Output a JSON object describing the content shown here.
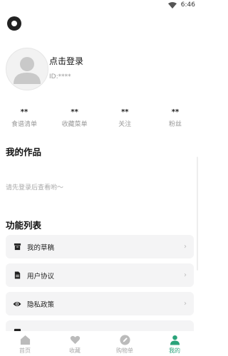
{
  "status_bar": {
    "time": "6:46"
  },
  "profile": {
    "login_text": "点击登录",
    "user_id": "ID:****"
  },
  "stats": [
    {
      "value": "**",
      "label": "食谱清单"
    },
    {
      "value": "**",
      "label": "收藏菜单"
    },
    {
      "value": "**",
      "label": "关注"
    },
    {
      "value": "**",
      "label": "粉丝"
    }
  ],
  "works": {
    "title": "我的作品",
    "empty_hint": "请先登录后查看哟～"
  },
  "functions": {
    "title": "功能列表",
    "items": [
      {
        "label": "我的草稿",
        "icon": "archive-icon"
      },
      {
        "label": "用户协议",
        "icon": "document-icon"
      },
      {
        "label": "隐私政策",
        "icon": "eye-icon"
      }
    ],
    "chevron": "›"
  },
  "tabbar": {
    "items": [
      {
        "label": "首页",
        "icon": "home-icon",
        "active": false
      },
      {
        "label": "收藏",
        "icon": "heart-icon",
        "active": false
      },
      {
        "label": "购物单",
        "icon": "pencil-icon",
        "active": false
      },
      {
        "label": "我的",
        "icon": "person-icon",
        "active": true
      }
    ],
    "active_color": "#2aa37a",
    "inactive_color": "#bbbbbb"
  }
}
